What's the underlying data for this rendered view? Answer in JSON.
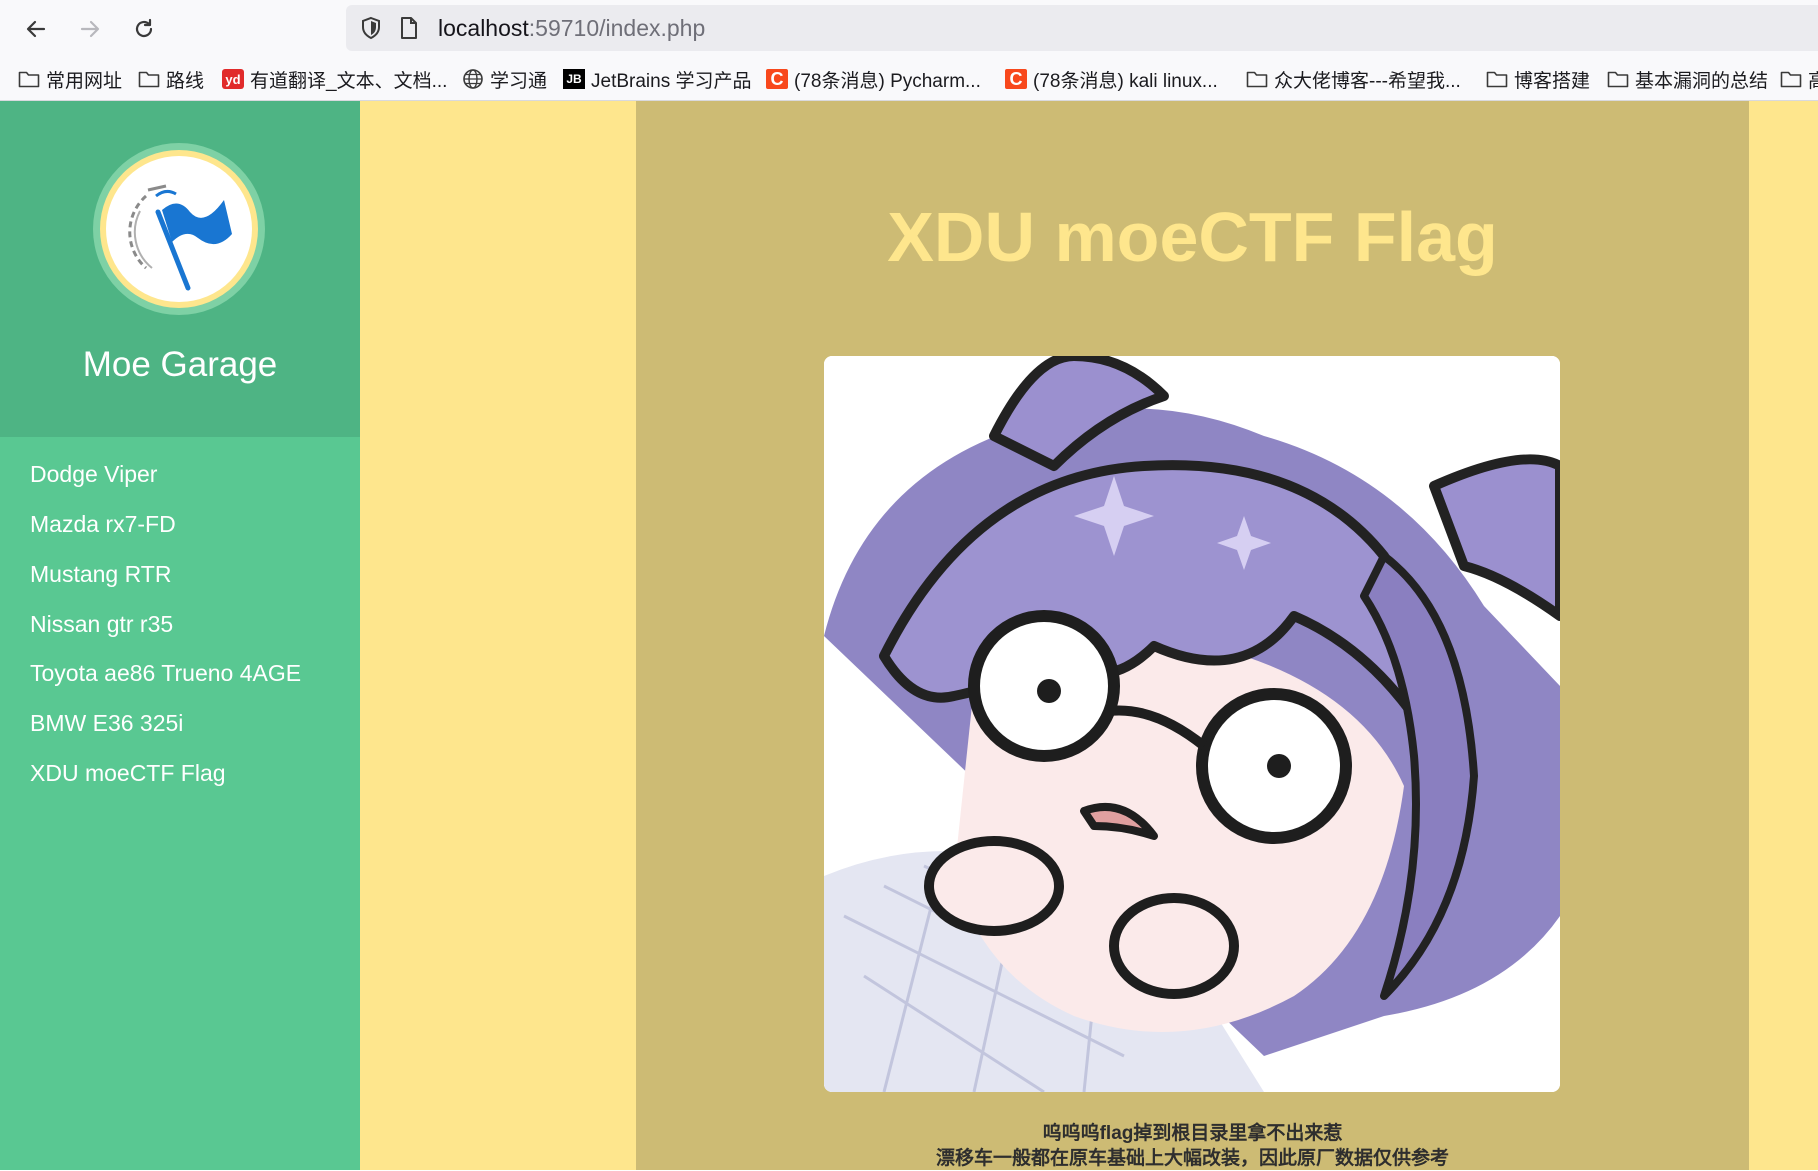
{
  "browser": {
    "url_host": "localhost",
    "url_rest": ":59710/index.php",
    "bookmarks": [
      {
        "label": "常用网址",
        "icon": "folder-icon"
      },
      {
        "label": "路线",
        "icon": "folder-icon"
      },
      {
        "label": "有道翻译_文本、文档...",
        "icon": "youdao-icon"
      },
      {
        "label": "学习通",
        "icon": "globe-icon"
      },
      {
        "label": "JetBrains 学习产品",
        "icon": "jetbrains-icon"
      },
      {
        "label": "(78条消息) Pycharm...",
        "icon": "csdn-icon"
      },
      {
        "label": "(78条消息) kali linux...",
        "icon": "csdn-icon"
      },
      {
        "label": "众大佬博客---希望我...",
        "icon": "folder-icon"
      },
      {
        "label": "博客搭建",
        "icon": "folder-icon"
      },
      {
        "label": "基本漏洞的总结",
        "icon": "folder-icon"
      },
      {
        "label": "高",
        "icon": "folder-icon"
      }
    ],
    "yd_glyph": "yd",
    "jb_glyph": "JB",
    "c_glyph": "C"
  },
  "sidebar": {
    "title": "Moe Garage",
    "items": [
      "Dodge Viper",
      "Mazda rx7-FD",
      "Mustang RTR",
      "Nissan gtr r35",
      "Toyota ae86 Trueno 4AGE",
      "BMW E36 325i",
      "XDU moeCTF Flag"
    ]
  },
  "main": {
    "heading": "XDU moeCTF Flag",
    "caption_line1": "呜呜呜flag掉到根目录里拿不出来惹",
    "caption_line2": "漂移车一般都在原车基础上大幅改装，因此原厂数据仅供参考"
  },
  "colors": {
    "sidebar": "#59c892",
    "sidebar_header": "#4eb484",
    "page_bg": "#fee68d",
    "content_bg": "#cdbb74",
    "heading": "#fee68d",
    "logo_flag": "#1976d2"
  }
}
